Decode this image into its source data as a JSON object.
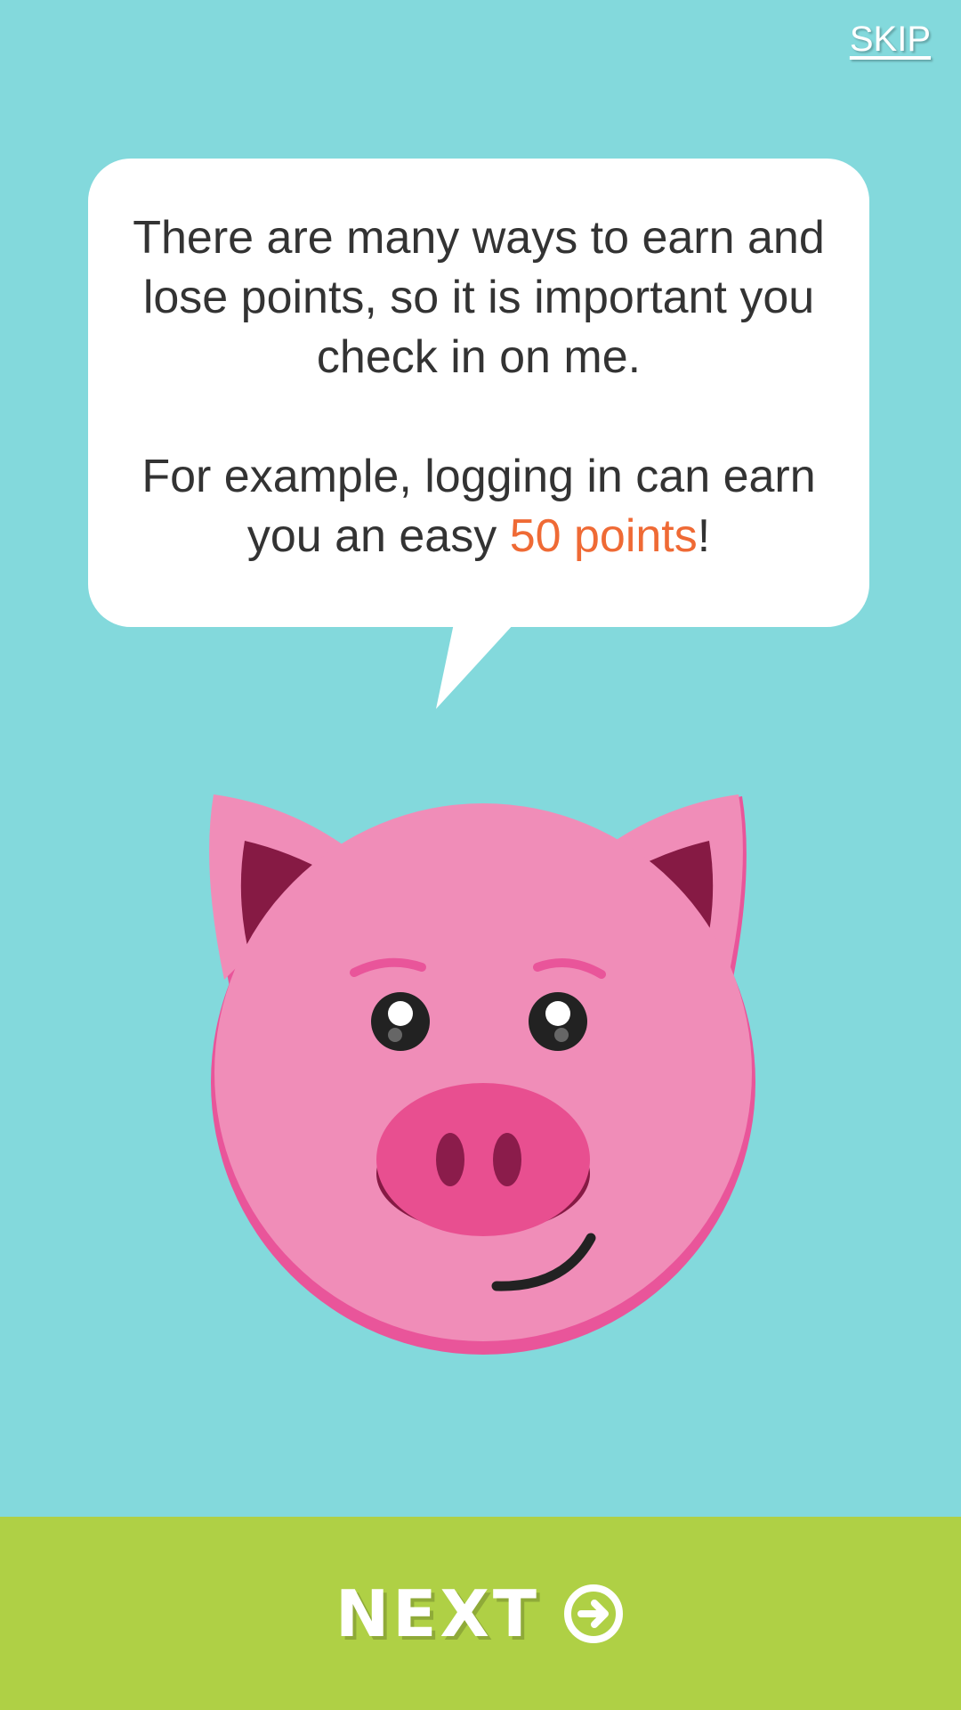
{
  "header": {
    "skip_label": "SKIP"
  },
  "speech_bubble": {
    "paragraph_1": "There are many ways to earn and lose points, so it is important you check in on me.",
    "paragraph_2_before": "For example, logging in can earn you an easy ",
    "paragraph_2_highlight": "50 points",
    "paragraph_2_after": "!"
  },
  "mascot": {
    "icon": "pig-mascot-icon"
  },
  "footer": {
    "next_label": "NEXT",
    "next_icon": "arrow-right-circle-icon"
  },
  "colors": {
    "background": "#83d9dc",
    "footer": "#afd045",
    "highlight": "#ef6a35",
    "pig": "#f08db8"
  }
}
